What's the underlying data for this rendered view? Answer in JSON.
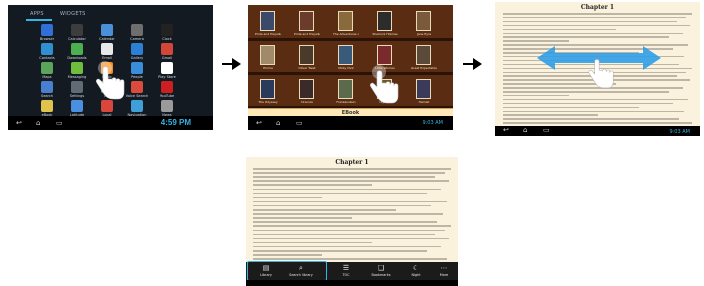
{
  "panel1": {
    "tabs": [
      "APPS",
      "WIDGETS"
    ],
    "apps": [
      {
        "label": "Browser",
        "color": "#2f6fd6"
      },
      {
        "label": "Calculator",
        "color": "#3d3d3d"
      },
      {
        "label": "Calendar",
        "color": "#4a8fd8"
      },
      {
        "label": "Camera",
        "color": "#6e6e6e"
      },
      {
        "label": "Clock",
        "color": "#222222"
      },
      {
        "label": "Contacts",
        "color": "#2f8fd0"
      },
      {
        "label": "Downloads",
        "color": "#4caf50"
      },
      {
        "label": "Email",
        "color": "#e8e8e8"
      },
      {
        "label": "Gallery",
        "color": "#2b7fd4"
      },
      {
        "label": "Gmail",
        "color": "#d44638"
      },
      {
        "label": "Maps",
        "color": "#5aa55a"
      },
      {
        "label": "Messaging",
        "color": "#6fbf3f"
      },
      {
        "label": "Music",
        "color": "#f28c1e"
      },
      {
        "label": "People",
        "color": "#3a8ddb"
      },
      {
        "label": "Play Store",
        "color": "#ffffff"
      },
      {
        "label": "Search",
        "color": "#4a7fd0"
      },
      {
        "label": "Settings",
        "color": "#5f6b75"
      },
      {
        "label": "Talk",
        "color": "#7fbf3f"
      },
      {
        "label": "Voice Search",
        "color": "#d94c3d"
      },
      {
        "label": "YouTube",
        "color": "#cc2020"
      },
      {
        "label": "eBook",
        "color": "#e0c34a"
      },
      {
        "label": "Latitude",
        "color": "#4a90e2"
      },
      {
        "label": "Local",
        "color": "#d9463b"
      },
      {
        "label": "Navigation",
        "color": "#3f9fd8"
      },
      {
        "label": "News",
        "color": "#9a9a9a"
      }
    ],
    "time": "4:59 PM"
  },
  "panel2": {
    "books": [
      {
        "title": "Pride and Prejudice",
        "color": "#3b4a6b"
      },
      {
        "title": "Pride and Prejudice",
        "color": "#6b3b2b"
      },
      {
        "title": "The Adventures of Tom",
        "color": "#8a6a3a"
      },
      {
        "title": "Sherlock Holmes",
        "color": "#2c2c2c"
      },
      {
        "title": "Jane Eyre",
        "color": "#7a5a3a"
      },
      {
        "title": "Emma",
        "color": "#a08a6a"
      },
      {
        "title": "Oliver Twist",
        "color": "#4a3a2a"
      },
      {
        "title": "Moby Dick",
        "color": "#3a5a7a"
      },
      {
        "title": "Little Women",
        "color": "#7a2a2a"
      },
      {
        "title": "Great Expectations",
        "color": "#5a4a3a"
      },
      {
        "title": "The Odyssey",
        "color": "#2a3a5a"
      },
      {
        "title": "Dracula",
        "color": "#3a2a2a"
      },
      {
        "title": "Frankenstein",
        "color": "#5a6a4a"
      },
      {
        "title": "Ulysses",
        "color": "#6a5a2a"
      },
      {
        "title": "Hamlet",
        "color": "#3a3a5a"
      }
    ],
    "bottom_label": "EBook",
    "time": "9:03 AM"
  },
  "panel3": {
    "chapter": "Chapter 1",
    "time": "9:03 AM"
  },
  "panel4": {
    "chapter": "Chapter 1",
    "toolbar": [
      {
        "label": "Library",
        "icon": "library-icon"
      },
      {
        "label": "Search library",
        "icon": "search-icon"
      },
      {
        "label": "TOC",
        "icon": "toc-icon"
      },
      {
        "label": "Bookmarks",
        "icon": "bookmark-icon"
      },
      {
        "label": "Night",
        "icon": "night-icon"
      },
      {
        "label": "More",
        "icon": "more-icon"
      }
    ]
  },
  "colors": {
    "accent": "#33b5e5",
    "arrow": "#000000"
  }
}
